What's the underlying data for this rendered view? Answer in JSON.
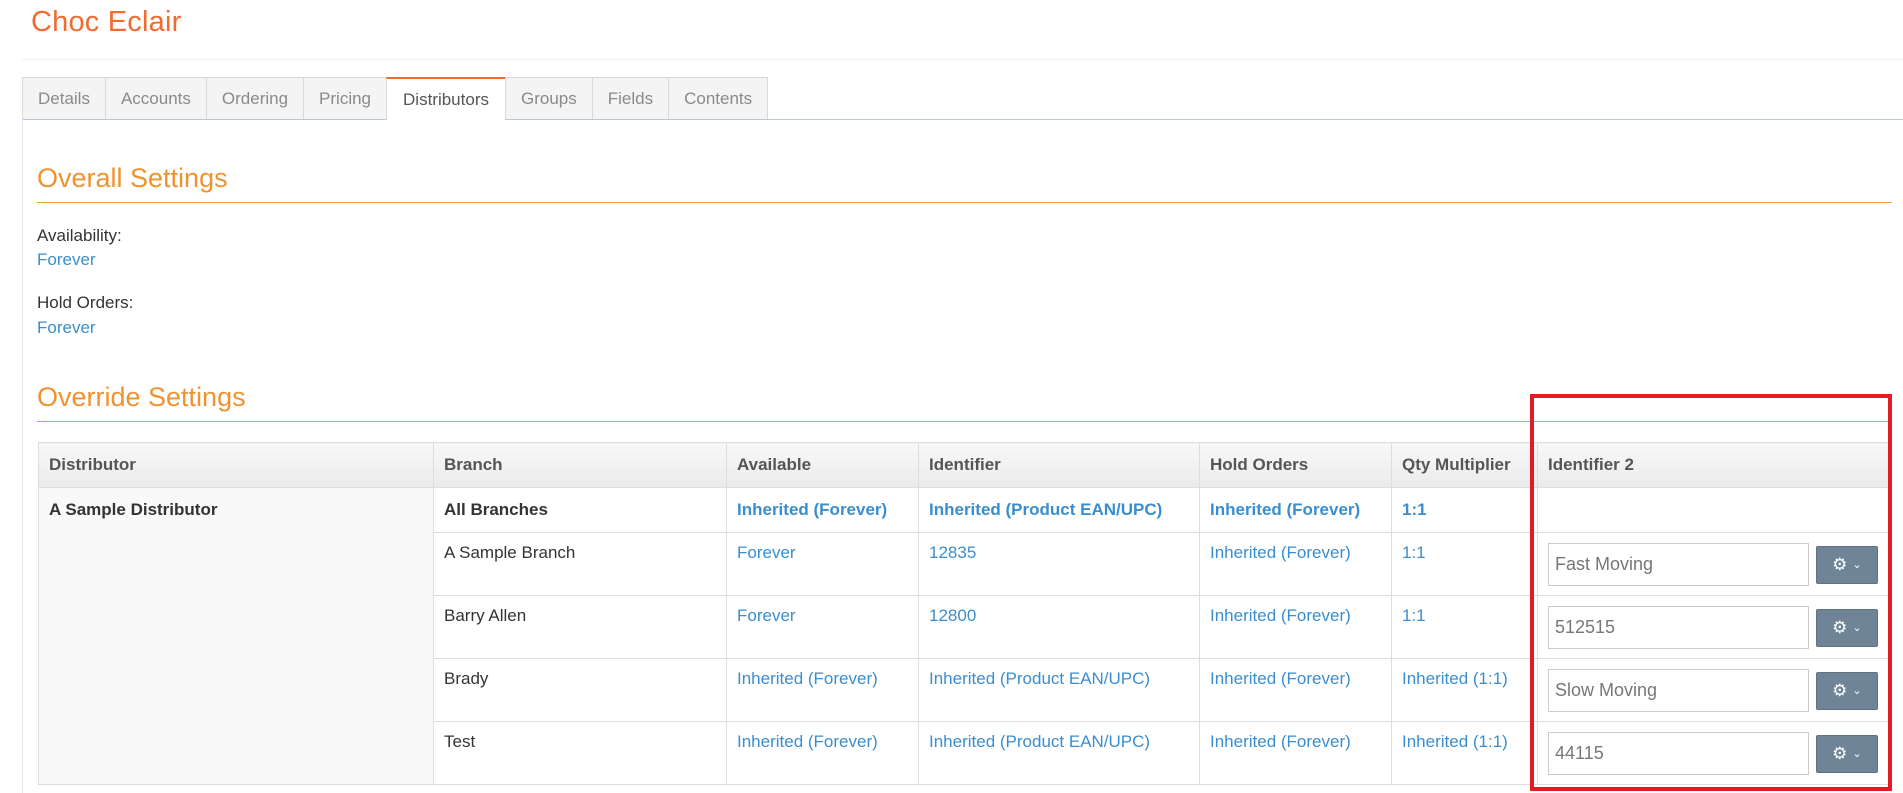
{
  "page": {
    "title": "Choc Eclair"
  },
  "tabs": [
    {
      "label": "Details",
      "active": false
    },
    {
      "label": "Accounts",
      "active": false
    },
    {
      "label": "Ordering",
      "active": false
    },
    {
      "label": "Pricing",
      "active": false
    },
    {
      "label": "Distributors",
      "active": true
    },
    {
      "label": "Groups",
      "active": false
    },
    {
      "label": "Fields",
      "active": false
    },
    {
      "label": "Contents",
      "active": false
    }
  ],
  "overall": {
    "heading": "Overall Settings",
    "availability_label": "Availability:",
    "availability_value": "Forever",
    "hold_orders_label": "Hold Orders:",
    "hold_orders_value": "Forever"
  },
  "override": {
    "heading": "Override Settings",
    "columns": [
      "Distributor",
      "Branch",
      "Available",
      "Identifier",
      "Hold Orders",
      "Qty Multiplier",
      "Identifier 2"
    ],
    "distributor": "A Sample Distributor",
    "rows": [
      {
        "branch": "All Branches",
        "available": "Inherited (Forever)",
        "identifier": "Inherited (Product EAN/UPC)",
        "hold_orders": "Inherited (Forever)",
        "qty_multiplier": "1:1",
        "identifier2": ""
      },
      {
        "branch": "A Sample Branch",
        "available": "Forever",
        "identifier": "12835",
        "hold_orders": "Inherited (Forever)",
        "qty_multiplier": "1:1",
        "identifier2": "Fast Moving"
      },
      {
        "branch": "Barry Allen",
        "available": "Forever",
        "identifier": "12800",
        "hold_orders": "Inherited (Forever)",
        "qty_multiplier": "1:1",
        "identifier2": "512515"
      },
      {
        "branch": "Brady",
        "available": "Inherited (Forever)",
        "identifier": "Inherited (Product EAN/UPC)",
        "hold_orders": "Inherited (Forever)",
        "qty_multiplier": "Inherited (1:1)",
        "identifier2": "Slow Moving"
      },
      {
        "branch": "Test",
        "available": "Inherited (Forever)",
        "identifier": "Inherited (Product EAN/UPC)",
        "hold_orders": "Inherited (Forever)",
        "qty_multiplier": "Inherited (1:1)",
        "identifier2": "44115"
      }
    ]
  },
  "icons": {
    "gear": "gear-icon",
    "chevron": "chevron-down-icon"
  },
  "colors": {
    "brand_orange": "#f26a2e",
    "section_orange": "#f0922f",
    "link_blue": "#3a8ed0",
    "highlight_red": "#e51b24",
    "button_slate": "#6f8496"
  }
}
